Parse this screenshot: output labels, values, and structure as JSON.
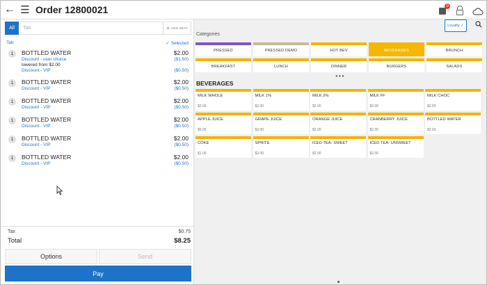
{
  "header": {
    "title": "Order 12800021",
    "icons": [
      "back-arrow-icon",
      "menu-icon",
      "shopping-bag-icon",
      "lock-icon",
      "cloud-icon"
    ],
    "badge_count": "0"
  },
  "order_panel": {
    "tab_all_label": "All",
    "tab_placeholder": "Tab",
    "add_seat_label": "ADD SEAT",
    "tab_label": "Tab",
    "selected_label": "Selected",
    "items": [
      {
        "qty": "1",
        "name": "BOTTLED WATER",
        "price": "$2.00",
        "modifiers": [
          {
            "label": "Discount - user choice",
            "price": "($1.50)"
          }
        ],
        "note": "lowered from $2.00",
        "discount": {
          "label": "Discount - VIP",
          "price": "($0.50)"
        }
      },
      {
        "qty": "1",
        "name": "BOTTLED WATER",
        "price": "$2.00",
        "discount": {
          "label": "Discount - VIP",
          "price": "($0.50)"
        }
      },
      {
        "qty": "1",
        "name": "BOTTLED WATER",
        "price": "$2.00",
        "discount": {
          "label": "Discount - VIP",
          "price": "($0.50)"
        }
      },
      {
        "qty": "1",
        "name": "BOTTLED WATER",
        "price": "$2.00",
        "discount": {
          "label": "Discount - VIP",
          "price": "($0.50)"
        }
      },
      {
        "qty": "1",
        "name": "BOTTLED WATER",
        "price": "$2.00",
        "discount": {
          "label": "Discount - VIP",
          "price": "($0.50)"
        }
      },
      {
        "qty": "1",
        "name": "BOTTLED WATER",
        "price": "$2.00",
        "discount": {
          "label": "Discount - VIP",
          "price": "($0.50)"
        }
      }
    ],
    "tax_label": "Tax",
    "tax_value": "$0.75",
    "total_label": "Total",
    "total_value": "$8.25",
    "options_label": "Options",
    "send_label": "Send",
    "pay_label": "Pay"
  },
  "menu_panel": {
    "loyalty_label": "Loyalty",
    "categories_title": "Categories",
    "categories": [
      {
        "label": "PRESSED",
        "color": "#7e57c2",
        "active": false
      },
      {
        "label": "PRESSED DEMO",
        "color": "#c8b89a",
        "active": false
      },
      {
        "label": "HOT BEV",
        "color": "#f4b400",
        "active": false
      },
      {
        "label": "BEVERAGES",
        "color": "#f4b400",
        "active": true
      },
      {
        "label": "BRUNCH",
        "color": "#f4b400",
        "active": false
      },
      {
        "label": "BREAKFAST",
        "color": "#f4b400",
        "active": false
      },
      {
        "label": "LUNCH",
        "color": "#f4b400",
        "active": false
      },
      {
        "label": "DINNER",
        "color": "#f4b400",
        "active": false
      },
      {
        "label": "BURGERS",
        "color": "#f4b400",
        "active": false
      },
      {
        "label": "SALADS",
        "color": "#f4b400",
        "active": false
      }
    ],
    "section_title": "BEVERAGES",
    "products": [
      {
        "name": "MILK WHOLE",
        "price": "$2.00"
      },
      {
        "name": "MILK 1%",
        "price": "$2.00"
      },
      {
        "name": "MILK 2%",
        "price": "$2.00"
      },
      {
        "name": "MILK FF",
        "price": "$2.00"
      },
      {
        "name": "MILK CHOC",
        "price": "$2.00"
      },
      {
        "name": "APPLE JUICE",
        "price": "$5.00"
      },
      {
        "name": "GRAPE JUICE",
        "price": "$2.00"
      },
      {
        "name": "ORANGE JUICE",
        "price": "$2.00"
      },
      {
        "name": "CRANBERRY JUICE",
        "price": "$2.00"
      },
      {
        "name": "BOTTLED WATER",
        "price": "$2.00"
      },
      {
        "name": "COKE",
        "price": "$1.00"
      },
      {
        "name": "SPRITE",
        "price": "$2.00"
      },
      {
        "name": "ICED TEA- SWEET",
        "price": "$2.00"
      },
      {
        "name": "ICED TEA- UNSWEET",
        "price": "$2.00"
      }
    ]
  },
  "colors": {
    "accent_blue": "#1e73c8",
    "category_yellow": "#f4b400",
    "active_category": "#f5b700",
    "badge_red": "#e53935"
  }
}
